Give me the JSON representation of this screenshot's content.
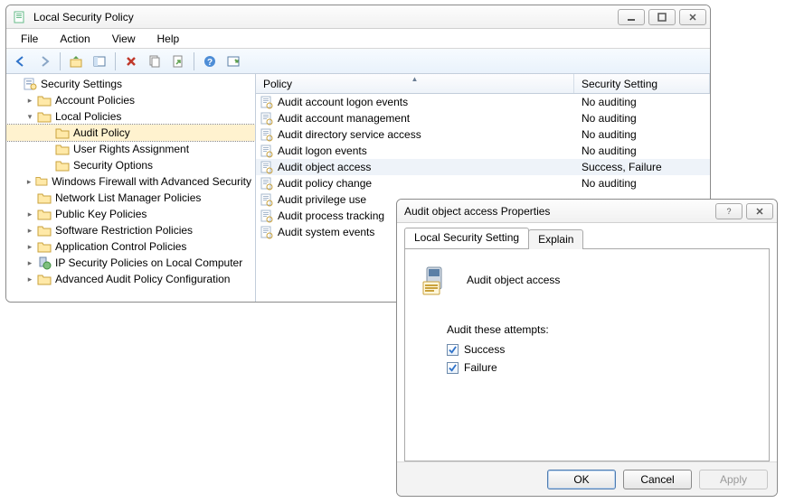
{
  "main": {
    "title": "Local Security Policy",
    "menus": [
      "File",
      "Action",
      "View",
      "Help"
    ],
    "toolbar_icons": [
      "back-icon",
      "forward-icon",
      "up-icon",
      "show-tree-icon",
      "delete-icon",
      "copy-icon",
      "export-icon",
      "help-icon",
      "properties-icon"
    ]
  },
  "tree": {
    "root_label": "Security Settings",
    "nodes": [
      {
        "label": "Account Policies",
        "expandable": true,
        "expanded": false,
        "depth": 1,
        "icon": "folder"
      },
      {
        "label": "Local Policies",
        "expandable": true,
        "expanded": true,
        "depth": 1,
        "icon": "folder",
        "children": [
          {
            "label": "Audit Policy",
            "depth": 2,
            "icon": "folder",
            "selected": true
          },
          {
            "label": "User Rights Assignment",
            "depth": 2,
            "icon": "folder"
          },
          {
            "label": "Security Options",
            "depth": 2,
            "icon": "folder"
          }
        ]
      },
      {
        "label": "Windows Firewall with Advanced Security",
        "expandable": true,
        "expanded": false,
        "depth": 1,
        "icon": "folder"
      },
      {
        "label": "Network List Manager Policies",
        "expandable": false,
        "depth": 1,
        "icon": "folder"
      },
      {
        "label": "Public Key Policies",
        "expandable": true,
        "expanded": false,
        "depth": 1,
        "icon": "folder"
      },
      {
        "label": "Software Restriction Policies",
        "expandable": true,
        "expanded": false,
        "depth": 1,
        "icon": "folder"
      },
      {
        "label": "Application Control Policies",
        "expandable": true,
        "expanded": false,
        "depth": 1,
        "icon": "folder"
      },
      {
        "label": "IP Security Policies on Local Computer",
        "expandable": true,
        "expanded": false,
        "depth": 1,
        "icon": "ipsec"
      },
      {
        "label": "Advanced Audit Policy Configuration",
        "expandable": true,
        "expanded": false,
        "depth": 1,
        "icon": "folder"
      }
    ]
  },
  "list": {
    "columns": {
      "policy": "Policy",
      "setting": "Security Setting"
    },
    "rows": [
      {
        "name": "Audit account logon events",
        "setting": "No auditing"
      },
      {
        "name": "Audit account management",
        "setting": "No auditing"
      },
      {
        "name": "Audit directory service access",
        "setting": "No auditing"
      },
      {
        "name": "Audit logon events",
        "setting": "No auditing"
      },
      {
        "name": "Audit object access",
        "setting": "Success, Failure",
        "selected": true
      },
      {
        "name": "Audit policy change",
        "setting": "No auditing"
      },
      {
        "name": "Audit privilege use",
        "setting": ""
      },
      {
        "name": "Audit process tracking",
        "setting": ""
      },
      {
        "name": "Audit system events",
        "setting": ""
      }
    ]
  },
  "dialog": {
    "title": "Audit object access Properties",
    "tabs": {
      "local": "Local Security Setting",
      "explain": "Explain"
    },
    "policy_name": "Audit object access",
    "prompt": "Audit these attempts:",
    "options": {
      "success": "Success",
      "failure": "Failure"
    },
    "checked": {
      "success": true,
      "failure": true
    },
    "buttons": {
      "ok": "OK",
      "cancel": "Cancel",
      "apply": "Apply"
    }
  }
}
